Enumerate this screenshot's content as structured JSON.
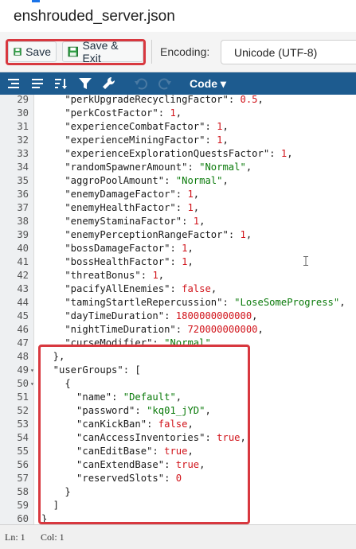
{
  "window": {
    "title": "enshrouded_server.json"
  },
  "toolbar": {
    "save_label": "Save",
    "save_exit_label": "Save & Exit",
    "encoding_label": "Encoding:",
    "encoding_value": "Unicode (UTF-8)"
  },
  "editor_toolbar": {
    "code_menu_label": "Code ▾"
  },
  "editor": {
    "lines": [
      {
        "n": "29",
        "tokens": [
          [
            "k",
            "    \"perkUpgradeRecyclingFactor\""
          ],
          [
            "p",
            ": "
          ],
          [
            "n",
            "0.5"
          ],
          [
            "p",
            ","
          ]
        ]
      },
      {
        "n": "30",
        "tokens": [
          [
            "k",
            "    \"perkCostFactor\""
          ],
          [
            "p",
            ": "
          ],
          [
            "n",
            "1"
          ],
          [
            "p",
            ","
          ]
        ]
      },
      {
        "n": "31",
        "tokens": [
          [
            "k",
            "    \"experienceCombatFactor\""
          ],
          [
            "p",
            ": "
          ],
          [
            "n",
            "1"
          ],
          [
            "p",
            ","
          ]
        ]
      },
      {
        "n": "32",
        "tokens": [
          [
            "k",
            "    \"experienceMiningFactor\""
          ],
          [
            "p",
            ": "
          ],
          [
            "n",
            "1"
          ],
          [
            "p",
            ","
          ]
        ]
      },
      {
        "n": "33",
        "tokens": [
          [
            "k",
            "    \"experienceExplorationQuestsFactor\""
          ],
          [
            "p",
            ": "
          ],
          [
            "n",
            "1"
          ],
          [
            "p",
            ","
          ]
        ]
      },
      {
        "n": "34",
        "tokens": [
          [
            "k",
            "    \"randomSpawnerAmount\""
          ],
          [
            "p",
            ": "
          ],
          [
            "s",
            "\"Normal\""
          ],
          [
            "p",
            ","
          ]
        ]
      },
      {
        "n": "35",
        "tokens": [
          [
            "k",
            "    \"aggroPoolAmount\""
          ],
          [
            "p",
            ": "
          ],
          [
            "s",
            "\"Normal\""
          ],
          [
            "p",
            ","
          ]
        ]
      },
      {
        "n": "36",
        "tokens": [
          [
            "k",
            "    \"enemyDamageFactor\""
          ],
          [
            "p",
            ": "
          ],
          [
            "n",
            "1"
          ],
          [
            "p",
            ","
          ]
        ]
      },
      {
        "n": "37",
        "tokens": [
          [
            "k",
            "    \"enemyHealthFactor\""
          ],
          [
            "p",
            ": "
          ],
          [
            "n",
            "1"
          ],
          [
            "p",
            ","
          ]
        ]
      },
      {
        "n": "38",
        "tokens": [
          [
            "k",
            "    \"enemyStaminaFactor\""
          ],
          [
            "p",
            ": "
          ],
          [
            "n",
            "1"
          ],
          [
            "p",
            ","
          ]
        ]
      },
      {
        "n": "39",
        "tokens": [
          [
            "k",
            "    \"enemyPerceptionRangeFactor\""
          ],
          [
            "p",
            ": "
          ],
          [
            "n",
            "1"
          ],
          [
            "p",
            ","
          ]
        ]
      },
      {
        "n": "40",
        "tokens": [
          [
            "k",
            "    \"bossDamageFactor\""
          ],
          [
            "p",
            ": "
          ],
          [
            "n",
            "1"
          ],
          [
            "p",
            ","
          ]
        ]
      },
      {
        "n": "41",
        "tokens": [
          [
            "k",
            "    \"bossHealthFactor\""
          ],
          [
            "p",
            ": "
          ],
          [
            "n",
            "1"
          ],
          [
            "p",
            ","
          ]
        ]
      },
      {
        "n": "42",
        "tokens": [
          [
            "k",
            "    \"threatBonus\""
          ],
          [
            "p",
            ": "
          ],
          [
            "n",
            "1"
          ],
          [
            "p",
            ","
          ]
        ]
      },
      {
        "n": "43",
        "tokens": [
          [
            "k",
            "    \"pacifyAllEnemies\""
          ],
          [
            "p",
            ": "
          ],
          [
            "b",
            "false"
          ],
          [
            "p",
            ","
          ]
        ]
      },
      {
        "n": "44",
        "tokens": [
          [
            "k",
            "    \"tamingStartleRepercussion\""
          ],
          [
            "p",
            ": "
          ],
          [
            "s",
            "\"LoseSomeProgress\""
          ],
          [
            "p",
            ","
          ]
        ]
      },
      {
        "n": "45",
        "tokens": [
          [
            "k",
            "    \"dayTimeDuration\""
          ],
          [
            "p",
            ": "
          ],
          [
            "n",
            "1800000000000"
          ],
          [
            "p",
            ","
          ]
        ]
      },
      {
        "n": "46",
        "tokens": [
          [
            "k",
            "    \"nightTimeDuration\""
          ],
          [
            "p",
            ": "
          ],
          [
            "n",
            "720000000000"
          ],
          [
            "p",
            ","
          ]
        ]
      },
      {
        "n": "47",
        "tokens": [
          [
            "k",
            "    \"curseModifier\""
          ],
          [
            "p",
            ": "
          ],
          [
            "s",
            "\"Normal\""
          ]
        ]
      },
      {
        "n": "48",
        "tokens": [
          [
            "p",
            "  },"
          ]
        ]
      },
      {
        "n": "49",
        "fold": true,
        "tokens": [
          [
            "k",
            "  \"userGroups\""
          ],
          [
            "p",
            ": ["
          ]
        ]
      },
      {
        "n": "50",
        "fold": true,
        "tokens": [
          [
            "p",
            "    {"
          ]
        ]
      },
      {
        "n": "51",
        "tokens": [
          [
            "k",
            "      \"name\""
          ],
          [
            "p",
            ": "
          ],
          [
            "s",
            "\"Default\""
          ],
          [
            "p",
            ","
          ]
        ]
      },
      {
        "n": "52",
        "tokens": [
          [
            "k",
            "      \"password\""
          ],
          [
            "p",
            ": "
          ],
          [
            "s",
            "\"kq01_jYD\""
          ],
          [
            "p",
            ","
          ]
        ]
      },
      {
        "n": "53",
        "tokens": [
          [
            "k",
            "      \"canKickBan\""
          ],
          [
            "p",
            ": "
          ],
          [
            "b",
            "false"
          ],
          [
            "p",
            ","
          ]
        ]
      },
      {
        "n": "54",
        "tokens": [
          [
            "k",
            "      \"canAccessInventories\""
          ],
          [
            "p",
            ": "
          ],
          [
            "b",
            "true"
          ],
          [
            "p",
            ","
          ]
        ]
      },
      {
        "n": "55",
        "tokens": [
          [
            "k",
            "      \"canEditBase\""
          ],
          [
            "p",
            ": "
          ],
          [
            "b",
            "true"
          ],
          [
            "p",
            ","
          ]
        ]
      },
      {
        "n": "56",
        "tokens": [
          [
            "k",
            "      \"canExtendBase\""
          ],
          [
            "p",
            ": "
          ],
          [
            "b",
            "true"
          ],
          [
            "p",
            ","
          ]
        ]
      },
      {
        "n": "57",
        "tokens": [
          [
            "k",
            "      \"reservedSlots\""
          ],
          [
            "p",
            ": "
          ],
          [
            "n",
            "0"
          ]
        ]
      },
      {
        "n": "58",
        "tokens": [
          [
            "p",
            "    }"
          ]
        ]
      },
      {
        "n": "59",
        "tokens": [
          [
            "p",
            "  ]"
          ]
        ]
      },
      {
        "n": "60",
        "tokens": [
          [
            "p",
            "}"
          ]
        ]
      }
    ]
  },
  "status": {
    "ln": "Ln: 1",
    "col": "Col: 1"
  },
  "colors": {
    "accent": "#1d5b8f",
    "highlight": "#d8383f"
  }
}
